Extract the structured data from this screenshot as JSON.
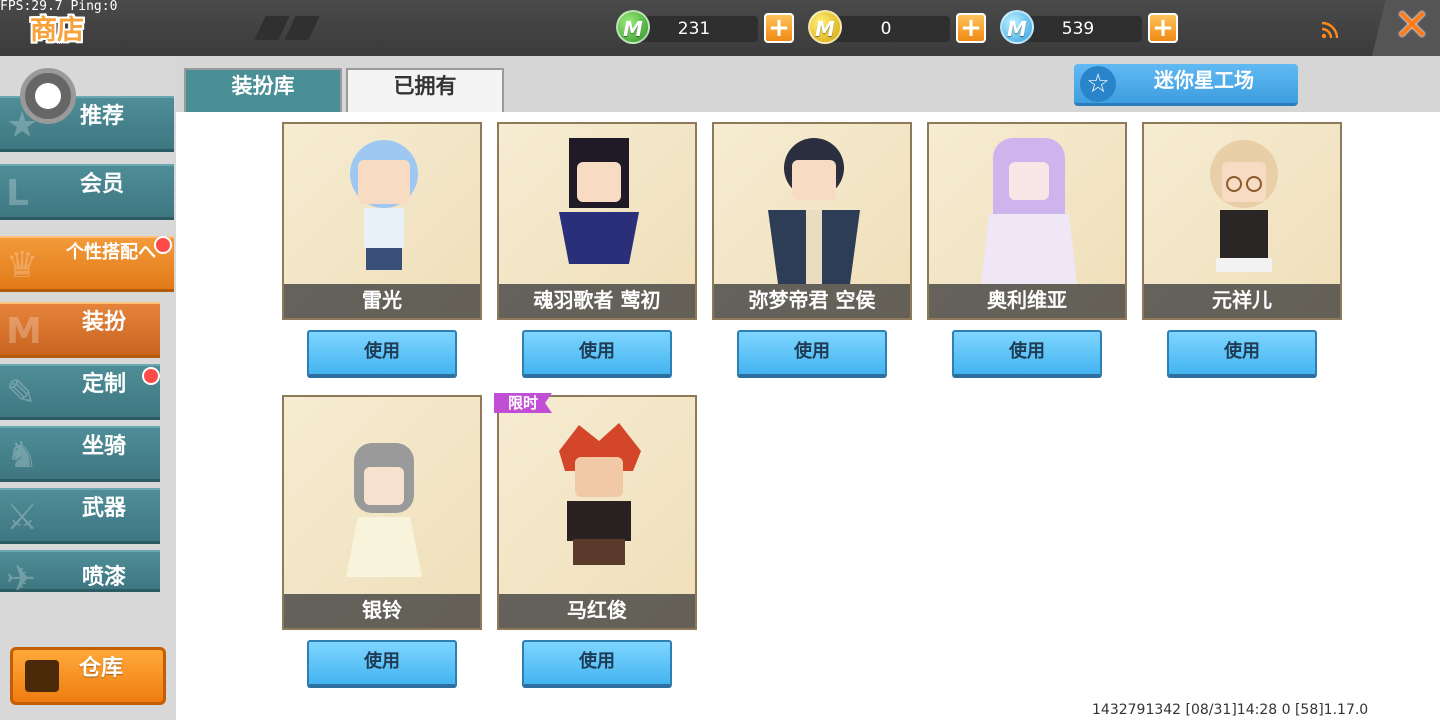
{
  "debug": "FPS:29.7  Ping:0",
  "header": {
    "title": "商店",
    "currencies": [
      {
        "name": "green-bean",
        "coin": "M",
        "value": "231"
      },
      {
        "name": "mini-coin",
        "coin": "M",
        "value": "0"
      },
      {
        "name": "mini-bean",
        "coin": "M",
        "value": "539"
      }
    ],
    "plus": "+",
    "close": "✕"
  },
  "sidebar": {
    "items": [
      {
        "label": "推荐"
      },
      {
        "label": "会员"
      },
      {
        "label": "个性搭配へ"
      },
      {
        "label": "装扮"
      },
      {
        "label": "定制"
      },
      {
        "label": "坐骑"
      },
      {
        "label": "武器"
      },
      {
        "label": "喷漆"
      }
    ],
    "warehouse": "仓库"
  },
  "tabs": [
    {
      "label": "装扮库"
    },
    {
      "label": "已拥有"
    }
  ],
  "workshop": "迷你星工场",
  "items": [
    {
      "name": "雷光",
      "action": "使用"
    },
    {
      "name": "魂羽歌者 莺初",
      "action": "使用"
    },
    {
      "name": "弥梦帝君 空侯",
      "action": "使用"
    },
    {
      "name": "奥利维亚",
      "action": "使用"
    },
    {
      "name": "元祥儿",
      "action": "使用"
    },
    {
      "name": "银铃",
      "action": "使用"
    },
    {
      "name": "马红俊",
      "action": "使用",
      "tag": "限时"
    }
  ],
  "footer": "1432791342    [08/31]14:28 0    [58]1.17.0",
  "colors": {
    "accent": "#f29a3a",
    "teal": "#4b8f96",
    "button": "#44b4f0"
  }
}
